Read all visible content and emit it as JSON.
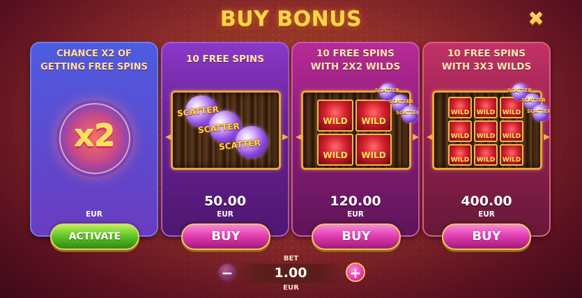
{
  "title": "BUY BONUS",
  "cards": [
    {
      "title_line1": "CHANCE X2 OF",
      "title_line2": "GETTING FREE SPINS",
      "multiplier": "x2",
      "price": "",
      "currency": "EUR",
      "button": "ACTIVATE"
    },
    {
      "title_line1": "10 FREE SPINS",
      "title_line2": "",
      "price": "50.00",
      "currency": "EUR",
      "button": "BUY",
      "symbol_label": "SCATTER"
    },
    {
      "title_line1": "10 FREE SPINS",
      "title_line2": "WITH 2X2 WILDS",
      "price": "120.00",
      "currency": "EUR",
      "button": "BUY",
      "symbol_label": "WILD",
      "scatter_label": "SCATTER"
    },
    {
      "title_line1": "10 FREE SPINS",
      "title_line2": "WITH 3X3 WILDS",
      "price": "400.00",
      "currency": "EUR",
      "button": "BUY",
      "symbol_label": "WILD",
      "scatter_label": "SCATTER"
    }
  ],
  "bet": {
    "label": "BET",
    "value": "1.00",
    "currency": "EUR",
    "minus": "−",
    "plus": "+"
  },
  "icons": {
    "close": "close-icon",
    "arrow_left": "arrow-left-icon",
    "arrow_right": "arrow-right-icon"
  },
  "colors": {
    "title": "#ffd64a",
    "buy_button": "#e03aae",
    "activate_button": "#5ec224"
  }
}
